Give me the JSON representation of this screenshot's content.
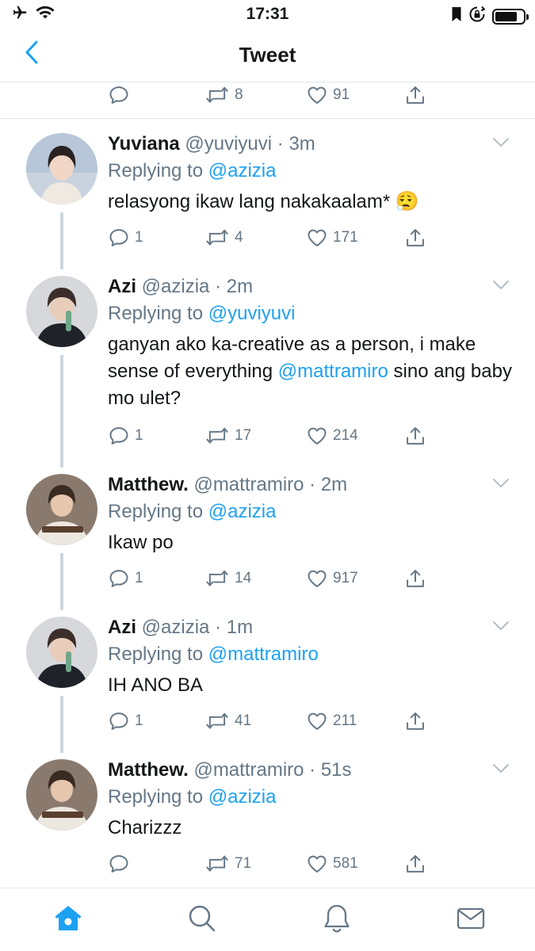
{
  "status_bar": {
    "time": "17:31",
    "battery_level": 0.8
  },
  "header": {
    "title": "Tweet",
    "back_icon": "chevron-left-icon"
  },
  "main_tweet_actions": {
    "reply_count": "",
    "retweet_count": "8",
    "like_count": "91"
  },
  "replies": [
    {
      "display_name": "Yuviana",
      "handle": "@yuviyuvi",
      "time": "3m",
      "replying_prefix": "Replying to",
      "replying_to": "@azizia",
      "text_parts": [
        "relasyong ikaw lang nakakaalam* 😮‍💨",
        "",
        ""
      ],
      "reply_count": "1",
      "retweet_count": "4",
      "like_count": "171"
    },
    {
      "display_name": "Azi",
      "handle": "@azizia",
      "time": "2m",
      "replying_prefix": "Replying to",
      "replying_to": "@yuviyuvi",
      "text_parts": [
        "ganyan ako ka-creative as a person, i make sense of everything ",
        "@mattramiro",
        " sino ang baby mo ulet?"
      ],
      "reply_count": "1",
      "retweet_count": "17",
      "like_count": "214"
    },
    {
      "display_name": "Matthew.",
      "handle": "@mattramiro",
      "time": "2m",
      "replying_prefix": "Replying to",
      "replying_to": "@azizia",
      "text_parts": [
        "Ikaw po",
        "",
        ""
      ],
      "reply_count": "1",
      "retweet_count": "14",
      "like_count": "917"
    },
    {
      "display_name": "Azi",
      "handle": "@azizia",
      "time": "1m",
      "replying_prefix": "Replying to",
      "replying_to": "@mattramiro",
      "text_parts": [
        "IH ANO BA",
        "",
        ""
      ],
      "reply_count": "1",
      "retweet_count": "41",
      "like_count": "211"
    },
    {
      "display_name": "Matthew.",
      "handle": "@mattramiro",
      "time": "51s",
      "replying_prefix": "Replying to",
      "replying_to": "@azizia",
      "text_parts": [
        "Charizzz",
        "",
        ""
      ],
      "reply_count": "",
      "retweet_count": "71",
      "like_count": "581"
    }
  ],
  "tab_bar": {
    "tabs": [
      "home-icon",
      "search-icon",
      "notifications-icon",
      "messages-icon"
    ],
    "active_color": "#1da1f2",
    "inactive_color": "#657786"
  }
}
